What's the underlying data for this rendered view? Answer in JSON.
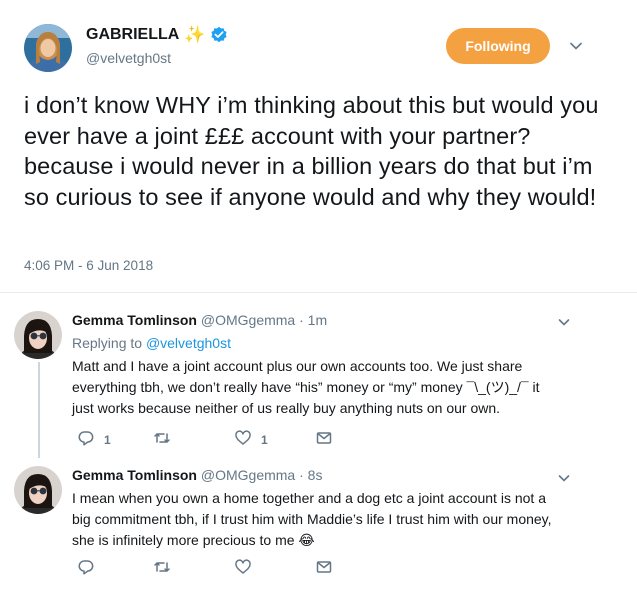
{
  "main_tweet": {
    "name": "GABRIELLA",
    "name_emoji": "✨",
    "handle": "@velvetgh0st",
    "follow_label": "Following",
    "text": "i don’t know WHY i’m thinking about this but would you ever have a joint £££ account with your partner? because i would never in a billion years do that but i’m so curious to see if anyone would and why they would!",
    "timestamp": "4:06 PM - 6 Jun 2018"
  },
  "replies": [
    {
      "name": "Gemma Tomlinson",
      "handle": "@OMGgemma",
      "time": "· 1m",
      "replying_prefix": "Replying to",
      "replying_handle": "@velvetgh0st",
      "text": "Matt and I have a joint account plus our own accounts too. We just share everything tbh, we don’t really have “his” money or “my” money ¯\\_(ツ)_/¯ it just works because neither of us really buy anything nuts on our own.",
      "reply_count": "1",
      "retweet_count": "",
      "like_count": "1"
    },
    {
      "name": "Gemma Tomlinson",
      "handle": "@OMGgemma",
      "time": "· 8s",
      "text": "I mean when you own a home together and a dog etc a joint account is not a big commitment tbh, if I trust him with Maddie’s life I trust him with our money, she is infinitely more precious to me 😂",
      "reply_count": "",
      "retweet_count": "",
      "like_count": ""
    }
  ],
  "colors": {
    "follow_button": "#f4a142",
    "verified": "#1da1f2",
    "link": "#1b95e0",
    "muted": "#657786"
  },
  "icons": [
    "verified-badge-icon",
    "chevron-down-icon",
    "reply-icon",
    "retweet-icon",
    "like-icon",
    "message-icon"
  ]
}
